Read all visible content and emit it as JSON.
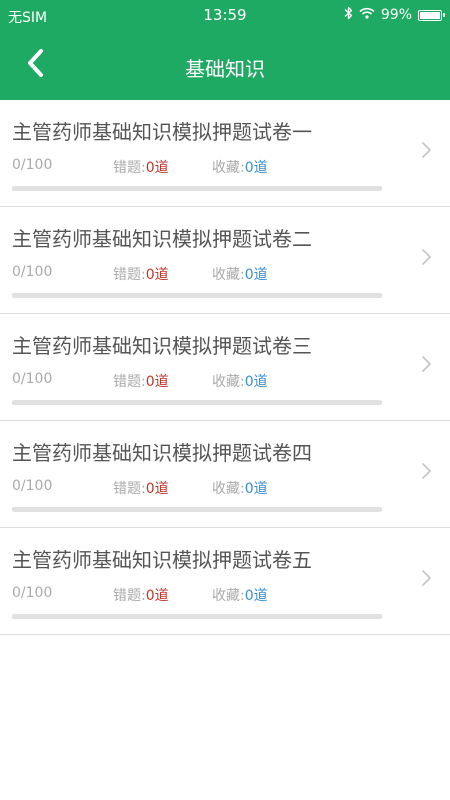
{
  "status_bar": {
    "carrier": "无SIM",
    "time": "13:59",
    "battery": "99%",
    "battery_level": 0.99
  },
  "nav": {
    "title": "基础知识",
    "back_icon": "chevron-left-icon"
  },
  "colors": {
    "primary": "#1faa63",
    "wrong": "#c0392b",
    "favorite": "#3a8fd0"
  },
  "exams": [
    {
      "title": "主管药师基础知识模拟押题试卷一",
      "progress": "0/100",
      "progress_fraction": 0,
      "wrong_label": "错题:",
      "wrong_count": "0道",
      "fav_label": "收藏:",
      "fav_count": "0道"
    },
    {
      "title": "主管药师基础知识模拟押题试卷二",
      "progress": "0/100",
      "progress_fraction": 0,
      "wrong_label": "错题:",
      "wrong_count": "0道",
      "fav_label": "收藏:",
      "fav_count": "0道"
    },
    {
      "title": "主管药师基础知识模拟押题试卷三",
      "progress": "0/100",
      "progress_fraction": 0,
      "wrong_label": "错题:",
      "wrong_count": "0道",
      "fav_label": "收藏:",
      "fav_count": "0道"
    },
    {
      "title": "主管药师基础知识模拟押题试卷四",
      "progress": "0/100",
      "progress_fraction": 0,
      "wrong_label": "错题:",
      "wrong_count": "0道",
      "fav_label": "收藏:",
      "fav_count": "0道"
    },
    {
      "title": "主管药师基础知识模拟押题试卷五",
      "progress": "0/100",
      "progress_fraction": 0,
      "wrong_label": "错题:",
      "wrong_count": "0道",
      "fav_label": "收藏:",
      "fav_count": "0道"
    }
  ]
}
